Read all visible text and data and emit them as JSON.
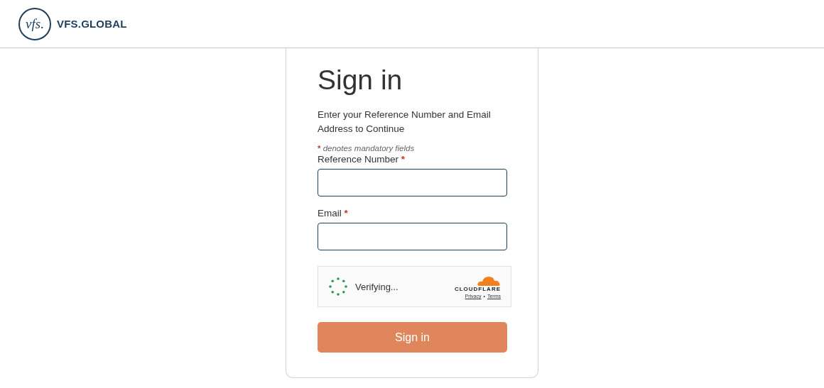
{
  "header": {
    "logo_mark": "vfs.",
    "logo_text": "VFS.GLOBAL"
  },
  "form": {
    "title": "Sign in",
    "intro": "Enter your Reference Number and Email Address to Continue",
    "mandatory_note": {
      "mark": "*",
      "text": "denotes mandatory fields"
    },
    "fields": [
      {
        "label": "Reference Number",
        "required_mark": "*"
      },
      {
        "label": "Email",
        "required_mark": "*"
      }
    ],
    "captcha": {
      "status": "Verifying...",
      "brand": "CLOUDFLARE",
      "links": [
        "Privacy",
        "Terms"
      ],
      "separator": "•"
    },
    "submit": {
      "label": "Sign in"
    }
  }
}
